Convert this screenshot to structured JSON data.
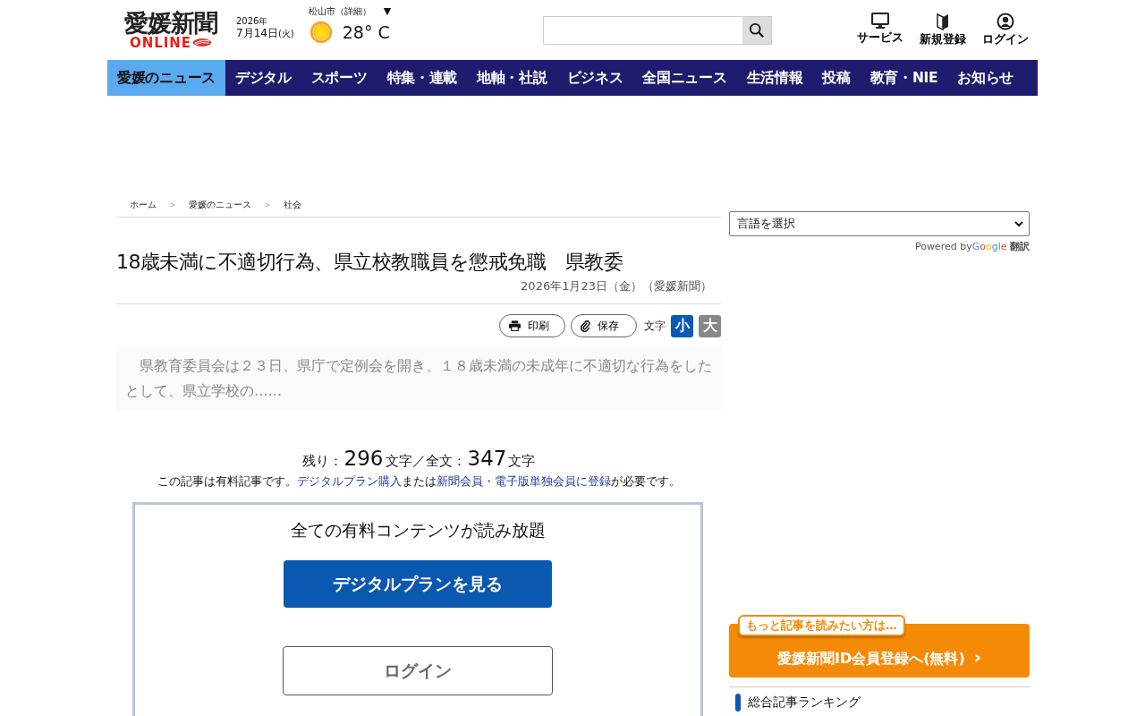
{
  "header": {
    "logo": {
      "name": "愛媛新聞",
      "sub": "ONLINE"
    },
    "date_year": "2026年",
    "date_day": "7月14日",
    "date_weekday": "(火)",
    "weather": {
      "location": "松山市（詳細）",
      "toggle": "▼",
      "temperature": "28° C"
    },
    "actions": [
      {
        "label": "サービス"
      },
      {
        "label": "新規登録"
      },
      {
        "label": "ログイン"
      }
    ]
  },
  "nav": [
    {
      "label": "愛媛のニュース",
      "selected": true
    },
    {
      "label": "デジタル",
      "selected": false
    },
    {
      "label": "スポーツ",
      "selected": false
    },
    {
      "label": "特集・連載",
      "selected": false
    },
    {
      "label": "地軸・社説",
      "selected": false
    },
    {
      "label": "ビジネス",
      "selected": false
    },
    {
      "label": "全国ニュース",
      "selected": false
    },
    {
      "label": "生活情報",
      "selected": false
    },
    {
      "label": "投稿",
      "selected": false
    },
    {
      "label": "教育・NIE",
      "selected": false
    },
    {
      "label": "お知らせ",
      "selected": false
    }
  ],
  "breadcrumb": [
    {
      "label": "ホーム"
    },
    {
      "label": "＞",
      "kind": "sep"
    },
    {
      "label": "愛媛のニュース"
    },
    {
      "label": "＞",
      "kind": "sep"
    },
    {
      "label": "社会"
    }
  ],
  "article": {
    "title": "18歳未満に不適切行為、県立校教職員を懲戒免職　県教委",
    "meta": "2026年1月23日（金）（愛媛新聞）",
    "tools": [
      {
        "label": "印刷"
      },
      {
        "label": "保存"
      }
    ],
    "text_size_label": "文字",
    "text_sizes": [
      {
        "label": "小",
        "selected": true
      },
      {
        "label": "大",
        "selected": false
      }
    ],
    "lead": "　県教育委員会は２３日、県庁で定例会を開き、１８歳未満の未成年に不適切な行為をしたとして、県立学校の……"
  },
  "paywall": {
    "count_parts": [
      {
        "kind": "text",
        "text": "残り："
      },
      {
        "kind": "number",
        "text": "296"
      },
      {
        "kind": "text",
        "text": "文字／全文："
      },
      {
        "kind": "number",
        "text": "347"
      },
      {
        "kind": "text",
        "text": "文字"
      }
    ],
    "notice": [
      {
        "kind": "text",
        "text": "この記事は有料記事です。"
      },
      {
        "kind": "link",
        "text": "デジタルプラン購入"
      },
      {
        "kind": "text",
        "text": "または"
      },
      {
        "kind": "link",
        "text": "新聞会員・電子版単独会員に登録"
      },
      {
        "kind": "text",
        "text": "が必要です。"
      }
    ],
    "box_title": "全ての有料コンテンツが読み放題",
    "plan_button": "デジタルプランを見る",
    "login_button": "ログイン"
  },
  "sidebar": {
    "language_select": "言語を選択",
    "powered_by": "Powered by",
    "google": "Google",
    "translate": "翻訳",
    "promo_tag": "もっと記事を読みたい方は…",
    "promo_button": "愛媛新聞ID会員登録へ(無料)",
    "promo_arrow": "›",
    "ranking_title": "総合記事ランキング"
  }
}
